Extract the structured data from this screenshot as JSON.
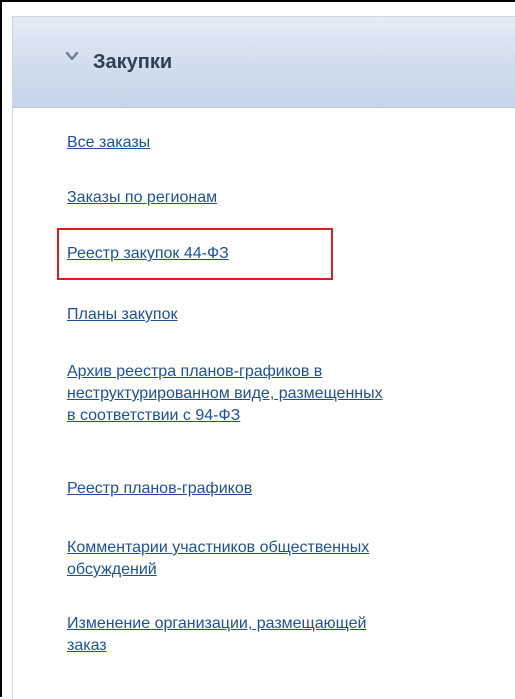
{
  "panel": {
    "title": "Закупки",
    "expand_icon": "chevron-down-icon"
  },
  "menu": {
    "items": [
      {
        "label": "Все заказы"
      },
      {
        "label": "Заказы по регионам"
      },
      {
        "label": "Реестр закупок 44-ФЗ",
        "highlighted": true
      },
      {
        "label": "Планы закупок"
      },
      {
        "label": "Архив реестра планов-графиков в\nнеструктурированном виде, размещенных\nв соответствии с 94-ФЗ"
      },
      {
        "label": "Реестр планов-графиков"
      },
      {
        "label": "Комментарии участников общественных\nобсуждений"
      },
      {
        "label": "Изменение организации, размещающей\nзаказ"
      }
    ]
  },
  "colors": {
    "link": "#1f4f9a",
    "header_gradient_top": "#e4ecf6",
    "header_gradient_bottom": "#c6d5e9",
    "highlight_border": "#e01b1b"
  }
}
